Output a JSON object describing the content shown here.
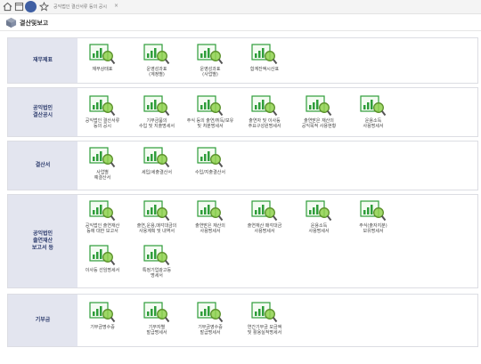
{
  "tab": {
    "label": "공익법인 결산서류 등의 공시",
    "close": "×"
  },
  "header": {
    "title": "결산및보고"
  },
  "colors": {
    "label_bg": "#e3e5ef",
    "label_text": "#2e3d6e",
    "icon_green": "#2e9d3a",
    "magnifier": "#8fd14f"
  },
  "sections": [
    {
      "label": "재무제표",
      "items": [
        {
          "label": "재무상태표"
        },
        {
          "label": "운영성과표\n(계정별)"
        },
        {
          "label": "운영성과표\n(사업별)"
        },
        {
          "label": "합계잔액시산표"
        }
      ]
    },
    {
      "label": "공익법인\n결산공시",
      "items": [
        {
          "label": "공익법인 결산서류\n등의 공시"
        },
        {
          "label": "기부금품의\n수입 및 지출명세서"
        },
        {
          "label": "주식 등의 출연/취득/보유\n및 처분명세서"
        },
        {
          "label": "출연자 및 이사등\n주요구성원명세서"
        },
        {
          "label": "출연받은 재산의\n공익목적 사용현황"
        },
        {
          "label": "운용소득\n사용명세서"
        }
      ]
    },
    {
      "label": "결산서",
      "items": [
        {
          "label": "사업별\n예결산서"
        },
        {
          "label": "세입/세출결산서"
        },
        {
          "label": "수입/지출결산서"
        }
      ]
    },
    {
      "label": "공익법인\n출연재산\n보고서 등",
      "items": [
        {
          "label": "공익법인 출연재산\n등에 대한 보고서"
        },
        {
          "label": "출연,운용,매각대금의\n사용계획 및 내역서"
        },
        {
          "label": "출연받은 재산의\n사용명세서"
        },
        {
          "label": "출연재산 매각대금\n사용명세서"
        },
        {
          "label": "운용소득\n사용명세서"
        },
        {
          "label": "주식(출자지분)\n보유명세서"
        },
        {
          "label": "이사등 선임명세서"
        },
        {
          "label": "특정기업광고등\n명세서"
        }
      ]
    },
    {
      "label": "기부금",
      "items": [
        {
          "label": "기부금명수증"
        },
        {
          "label": "기부자별\n발급명세서"
        },
        {
          "label": "기부금영수증\n발급명세서"
        },
        {
          "label": "연간기부금 모금액\n및 활용실적명세서"
        }
      ]
    }
  ]
}
